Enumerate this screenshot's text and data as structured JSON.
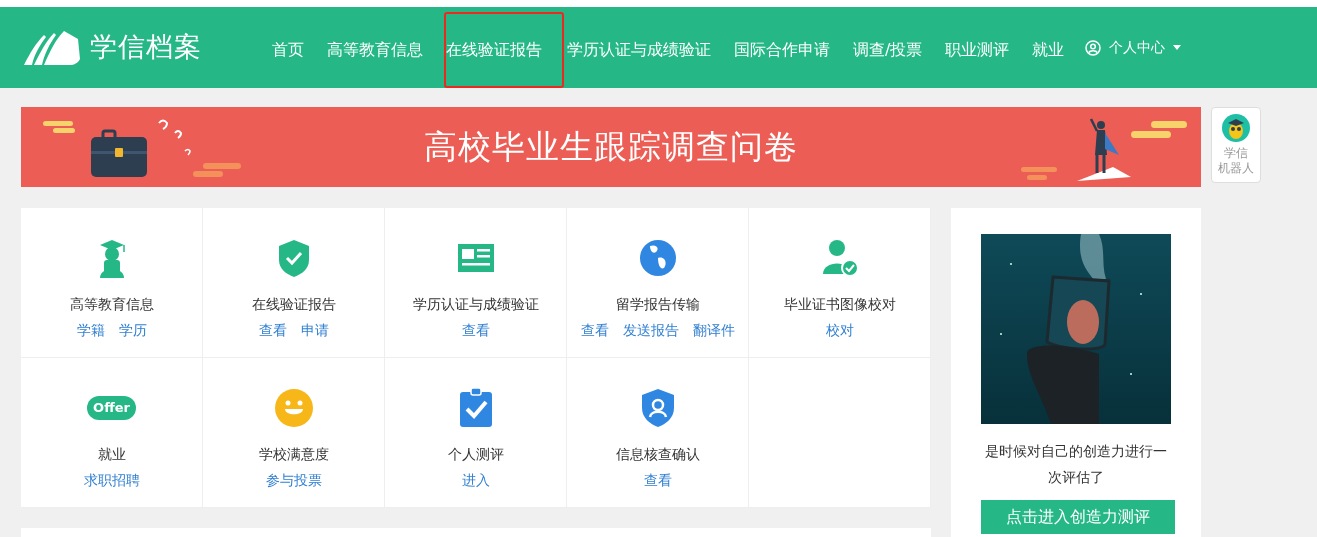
{
  "header": {
    "logo_text": "学信档案",
    "nav": [
      {
        "label": "首页",
        "highlighted": false
      },
      {
        "label": "高等教育信息",
        "highlighted": false
      },
      {
        "label": "在线验证报告",
        "highlighted": true
      },
      {
        "label": "学历认证与成绩验证",
        "highlighted": false
      },
      {
        "label": "国际合作申请",
        "highlighted": false
      },
      {
        "label": "调查/投票",
        "highlighted": false
      },
      {
        "label": "职业测评",
        "highlighted": false
      },
      {
        "label": "就业",
        "highlighted": false
      }
    ],
    "user_menu": {
      "label": "个人中心"
    }
  },
  "banner": {
    "title": "高校毕业生跟踪调查问卷"
  },
  "robot": {
    "label_lines": [
      "学信",
      "机器人"
    ]
  },
  "services": [
    {
      "title": "高等教育信息",
      "links": [
        "学籍",
        "学历"
      ]
    },
    {
      "title": "在线验证报告",
      "links": [
        "查看",
        "申请"
      ]
    },
    {
      "title": "学历认证与成绩验证",
      "links": [
        "查看"
      ]
    },
    {
      "title": "留学报告传输",
      "links": [
        "查看",
        "发送报告",
        "翻译件"
      ]
    },
    {
      "title": "毕业证书图像校对",
      "links": [
        "校对"
      ]
    },
    {
      "title": "就业",
      "badge": "Offer",
      "links": [
        "求职招聘"
      ]
    },
    {
      "title": "学校满意度",
      "links": [
        "参与投票"
      ]
    },
    {
      "title": "个人测评",
      "links": [
        "进入"
      ]
    },
    {
      "title": "信息核查确认",
      "links": [
        "查看"
      ]
    }
  ],
  "promo": {
    "text": "是时候对自己的创造力进行一次评估了",
    "button": "点击进入创造力测评"
  }
}
